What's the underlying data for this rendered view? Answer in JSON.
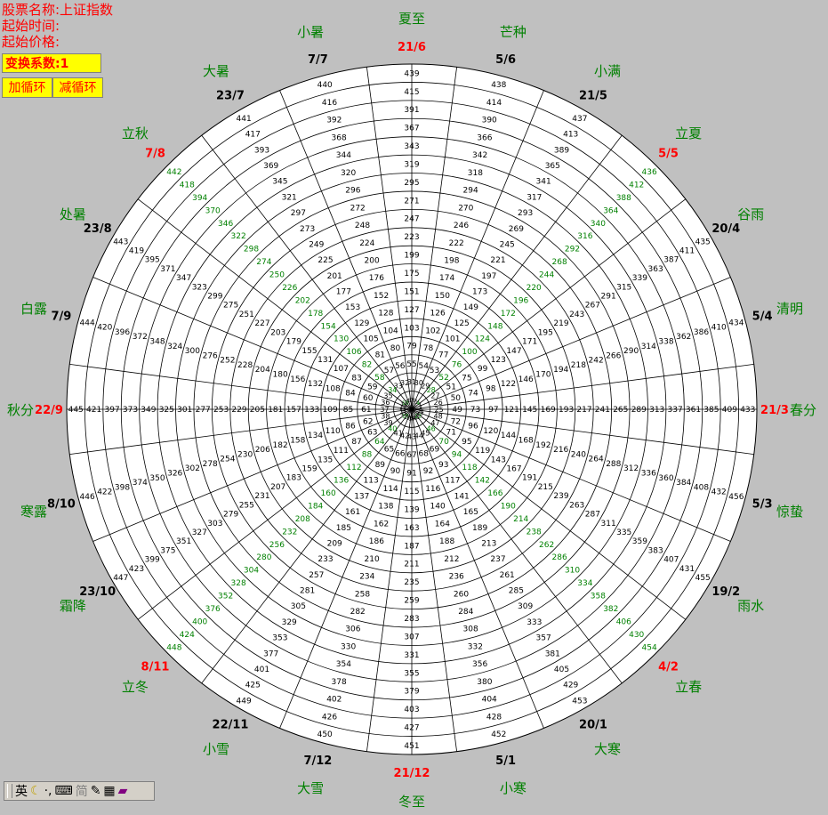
{
  "info": {
    "stock_name": "股票名称:上证指数",
    "start_time": "起始时间:",
    "start_price": "起始价格:"
  },
  "controls": {
    "coefficient": "变换系数:1",
    "add_cycle": "加循环",
    "sub_cycle": "减循环"
  },
  "wheel": {
    "spokes": 24,
    "rings": 19,
    "max_number": 456,
    "dates": [
      "21/3",
      "5/4",
      "20/4",
      "5/5",
      "21/5",
      "5/6",
      "21/6",
      "7/7",
      "23/7",
      "7/8",
      "23/8",
      "7/9",
      "22/9",
      "8/10",
      "23/10",
      "8/11",
      "22/11",
      "7/12",
      "21/12",
      "5/1",
      "20/1",
      "4/2",
      "19/2",
      "5/3"
    ],
    "terms": [
      "春分",
      "清明",
      "谷雨",
      "立夏",
      "小满",
      "芒种",
      "夏至",
      "小暑",
      "大暑",
      "立秋",
      "处暑",
      "白露",
      "秋分",
      "寒露",
      "霜降",
      "立冬",
      "小雪",
      "大雪",
      "冬至",
      "小寒",
      "大寒",
      "立春",
      "雨水",
      "惊蛰"
    ],
    "highlight_dates": [
      "21/3",
      "5/5",
      "21/6",
      "7/8",
      "22/9",
      "8/11",
      "21/12",
      "4/2"
    ]
  },
  "colors": {
    "background": "#c0c0c0",
    "wheel": "#ffffff",
    "term_text": "#008000",
    "date_text": "#000000",
    "date_highlight": "#ff0000",
    "number_text": "#000000",
    "diagonal_number": "#008000"
  },
  "taskbar": {
    "ime_label": "英",
    "simplified_label": "简"
  }
}
